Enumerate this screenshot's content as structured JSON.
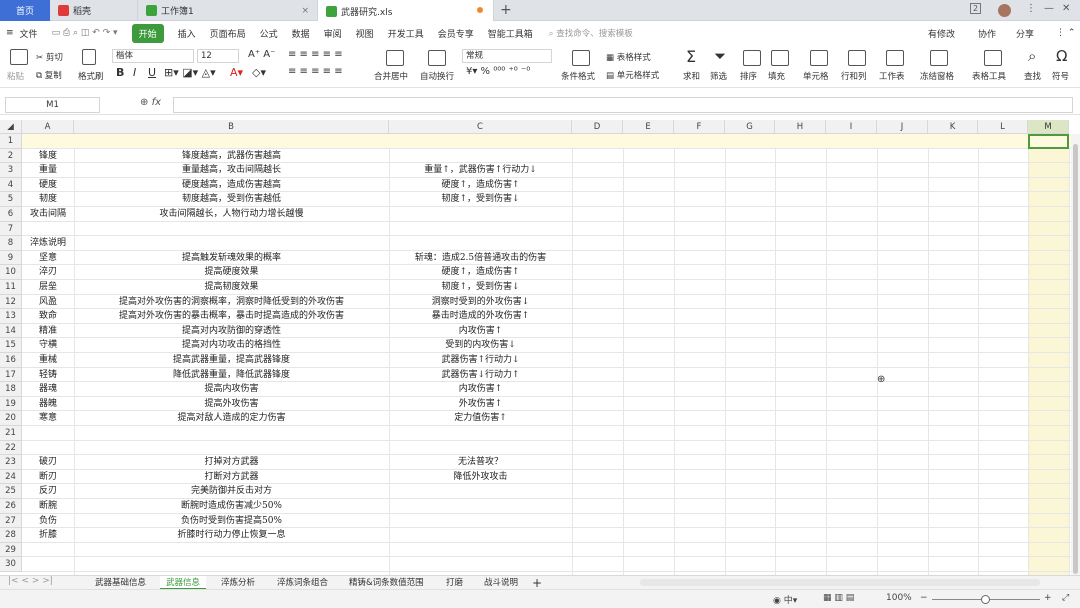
{
  "tabs": {
    "home": "首页",
    "doc1": "稻壳",
    "doc2": "工作簿1",
    "doc3": "武器研究.xls",
    "new": "+"
  },
  "menu": {
    "file": "文件",
    "items": [
      "开始",
      "插入",
      "页面布局",
      "公式",
      "数据",
      "审阅",
      "视图",
      "开发工具",
      "会员专享",
      "智能工具箱"
    ],
    "search": "查找命令、搜索模板",
    "right": [
      "有修改",
      "协作",
      "分享"
    ]
  },
  "ribbon": {
    "cut": "剪切",
    "copy": "复制",
    "paste": "粘贴",
    "format_painter": "格式刷",
    "font": "楷体",
    "size": "12",
    "number_format": "常规",
    "merge": "合并居中",
    "wrap": "自动换行",
    "cond_format": "条件格式",
    "table_style": "表格样式",
    "cell_style": "单元格样式",
    "sum": "求和",
    "filter": "筛选",
    "sort": "排序",
    "fill": "填充",
    "cell": "单元格",
    "rowcol": "行和列",
    "sheet": "工作表",
    "freeze": "冻结窗格",
    "table_tools": "表格工具",
    "find": "查找",
    "symbol": "符号"
  },
  "formula": {
    "namebox": "M1",
    "fx": "fx",
    "value": ""
  },
  "columns": [
    "A",
    "B",
    "C",
    "D",
    "E",
    "F",
    "G",
    "H",
    "I",
    "J",
    "K",
    "L",
    "M"
  ],
  "rows": [
    {
      "n": "1",
      "a": "",
      "b": "",
      "c": ""
    },
    {
      "n": "2",
      "a": "锋度",
      "b": "锋度越高，武器伤害越高",
      "c": ""
    },
    {
      "n": "3",
      "a": "重量",
      "b": "重量越高，攻击间隔越长",
      "c": "重量↑，武器伤害↑行动力↓"
    },
    {
      "n": "4",
      "a": "硬度",
      "b": "硬度越高，造成伤害越高",
      "c": "硬度↑，造成伤害↑"
    },
    {
      "n": "5",
      "a": "韧度",
      "b": "韧度越高，受到伤害越低",
      "c": "韧度↑，受到伤害↓"
    },
    {
      "n": "6",
      "a": "攻击间隔",
      "b": "攻击间隔越长，人物行动力增长越慢",
      "c": ""
    },
    {
      "n": "7",
      "a": "",
      "b": "",
      "c": ""
    },
    {
      "n": "8",
      "a": "淬炼说明",
      "b": "",
      "c": ""
    },
    {
      "n": "9",
      "a": "坚意",
      "b": "提高触发斩魂效果的概率",
      "c": "斩魂：造成2.5倍普通攻击的伤害"
    },
    {
      "n": "10",
      "a": "淬刃",
      "b": "提高硬度效果",
      "c": "硬度↑，造成伤害↑"
    },
    {
      "n": "11",
      "a": "层垒",
      "b": "提高韧度效果",
      "c": "韧度↑，受到伤害↓"
    },
    {
      "n": "12",
      "a": "风盈",
      "b": "提高对外攻伤害的洞察概率，洞察时降低受到的外攻伤害",
      "c": "洞察时受到的外攻伤害↓"
    },
    {
      "n": "13",
      "a": "致命",
      "b": "提高对外攻伤害的暴击概率，暴击时提高造成的外攻伤害",
      "c": "暴击时造成的外攻伤害↑"
    },
    {
      "n": "14",
      "a": "精准",
      "b": "提高对内攻防御的穿透性",
      "c": "内攻伤害↑"
    },
    {
      "n": "15",
      "a": "守横",
      "b": "提高对内功攻击的格挡性",
      "c": "受到的内攻伤害↓"
    },
    {
      "n": "16",
      "a": "重械",
      "b": "提高武器重量，提高武器锋度",
      "c": "武器伤害↑行动力↓"
    },
    {
      "n": "17",
      "a": "轻铸",
      "b": "降低武器重量，降低武器锋度",
      "c": "武器伤害↓行动力↑"
    },
    {
      "n": "18",
      "a": "器魂",
      "b": "提高内攻伤害",
      "c": "内攻伤害↑"
    },
    {
      "n": "19",
      "a": "器魄",
      "b": "提高外攻伤害",
      "c": "外攻伤害↑"
    },
    {
      "n": "20",
      "a": "寒意",
      "b": "提高对敌人造成的定力伤害",
      "c": "定力值伤害↑"
    },
    {
      "n": "21",
      "a": "",
      "b": "",
      "c": ""
    },
    {
      "n": "22",
      "a": "",
      "b": "",
      "c": ""
    },
    {
      "n": "23",
      "a": "破刃",
      "b": "打掉对方武器",
      "c": "无法普攻？"
    },
    {
      "n": "24",
      "a": "断刃",
      "b": "打断对方武器",
      "c": "降低外攻攻击"
    },
    {
      "n": "25",
      "a": "反刃",
      "b": "完美防御并反击对方",
      "c": ""
    },
    {
      "n": "26",
      "a": "断腕",
      "b": "断腕时造成伤害减少50%",
      "c": ""
    },
    {
      "n": "27",
      "a": "负伤",
      "b": "负伤时受到伤害提高50%",
      "c": ""
    },
    {
      "n": "28",
      "a": "折膝",
      "b": "折膝时行动力停止恢复一息",
      "c": ""
    },
    {
      "n": "29",
      "a": "",
      "b": "",
      "c": ""
    },
    {
      "n": "30",
      "a": "",
      "b": "",
      "c": ""
    }
  ],
  "sheets": [
    "武器基础信息",
    "武器信息",
    "淬炼分析",
    "淬炼词条组合",
    "精铸&词条数值范围",
    "打磨",
    "战斗说明"
  ],
  "active_sheet": "武器信息",
  "status": {
    "zoom": "100%",
    "minus": "−",
    "plus": "+"
  },
  "colors": {
    "accent": "#3d9a3d",
    "home_tab": "#3d6fd6",
    "row1": "#fdfae0",
    "colM": "#fbf7d6"
  }
}
